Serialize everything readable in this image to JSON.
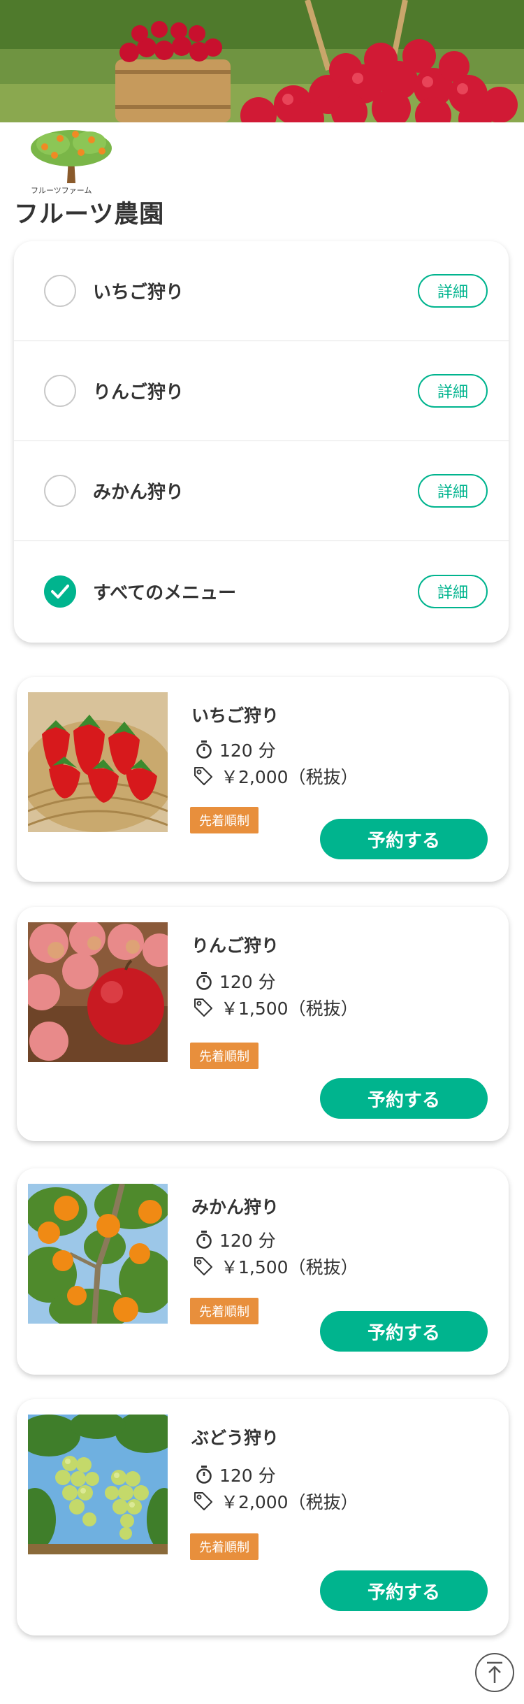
{
  "header": {
    "logo_text": "フルーツファーム",
    "title": "フルーツ農園"
  },
  "menu": {
    "items": [
      {
        "label": "いちご狩り",
        "detail": "詳細",
        "checked": false
      },
      {
        "label": "りんご狩り",
        "detail": "詳細",
        "checked": false
      },
      {
        "label": "みかん狩り",
        "detail": "詳細",
        "checked": false
      },
      {
        "label": "すべてのメニュー",
        "detail": "詳細",
        "checked": true
      }
    ]
  },
  "products": [
    {
      "title": "いちご狩り",
      "duration": "120 分",
      "price": "￥2,000（税抜）",
      "badge": "先着順制",
      "button": "予約する",
      "image": "strawberry-photo"
    },
    {
      "title": "りんご狩り",
      "duration": "120 分",
      "price": "￥1,500（税抜）",
      "badge": "先着順制",
      "button": "予約する",
      "image": "apple-photo"
    },
    {
      "title": "みかん狩り",
      "duration": "120 分",
      "price": "￥1,500（税抜）",
      "badge": "先着順制",
      "button": "予約する",
      "image": "mikan-photo"
    },
    {
      "title": "ぶどう狩り",
      "duration": "120 分",
      "price": "￥2,000（税抜）",
      "badge": "先着順制",
      "button": "予約する",
      "image": "grape-photo"
    }
  ],
  "colors": {
    "accent": "#00b48e",
    "badge": "#e88f3c",
    "text": "#333333"
  },
  "icons": {
    "timer": "stopwatch-icon",
    "price": "tag-icon",
    "check": "check-icon",
    "scroll_top": "arrow-up-icon"
  }
}
